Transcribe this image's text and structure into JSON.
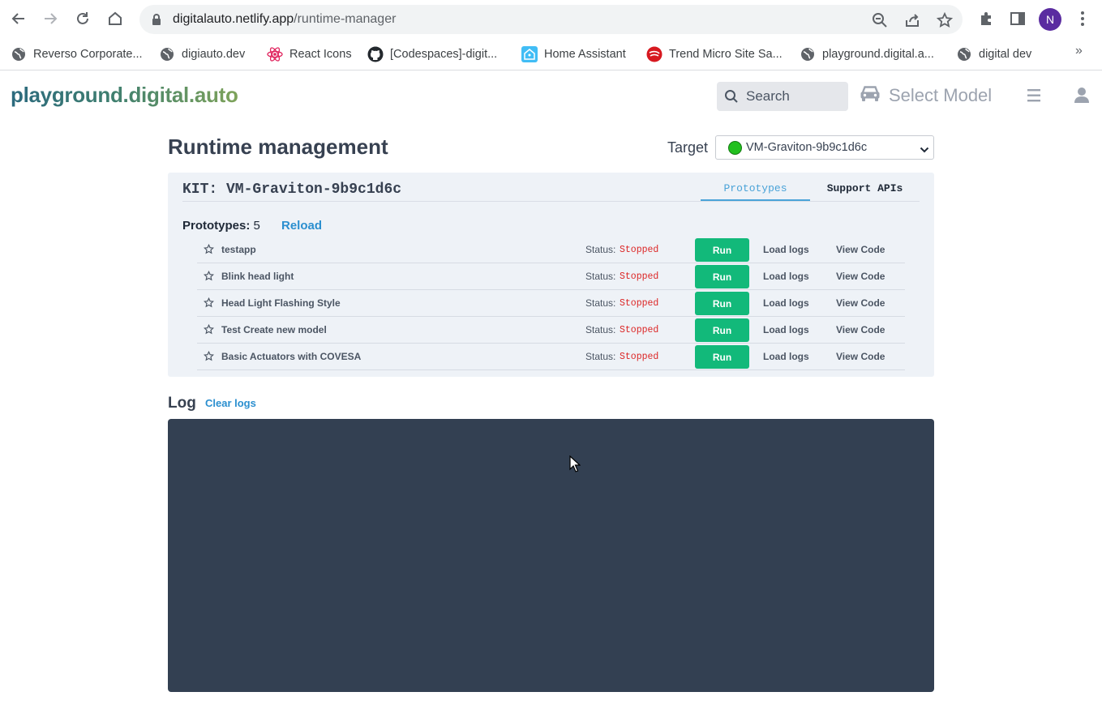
{
  "browser": {
    "url_domain": "digitalauto.netlify.app",
    "url_path": "/runtime-manager",
    "profile_initial": "N",
    "bookmarks": [
      {
        "label": "Reverso Corporate...",
        "icon": "globe-icon"
      },
      {
        "label": "digiauto.dev",
        "icon": "globe-icon"
      },
      {
        "label": "React Icons",
        "icon": "react-icon"
      },
      {
        "label": "[Codespaces]-digit...",
        "icon": "github-icon"
      },
      {
        "label": "Home Assistant",
        "icon": "home-assistant-icon"
      },
      {
        "label": "Trend Micro Site Sa...",
        "icon": "trend-micro-icon"
      },
      {
        "label": "playground.digital.a...",
        "icon": "globe-icon"
      },
      {
        "label": "digital dev",
        "icon": "globe-icon"
      }
    ],
    "more_bookmarks": "»"
  },
  "header": {
    "logo": "playground.digital.auto",
    "search_placeholder": "Search",
    "select_model": "Select Model"
  },
  "main": {
    "title": "Runtime management",
    "target_label": "Target",
    "target_value": "VM-Graviton-9b9c1d6c",
    "target_status_color": "#22c01f",
    "kit": {
      "title": "KIT: VM-Graviton-9b9c1d6c",
      "tabs": [
        {
          "label": "Prototypes",
          "active": true
        },
        {
          "label": "Support APIs",
          "active": false
        }
      ],
      "prototypes_label": "Prototypes:",
      "prototypes_count": "5",
      "reload_label": "Reload",
      "status_label": "Status:",
      "run_label": "Run",
      "load_logs_label": "Load logs",
      "view_code_label": "View Code",
      "prototypes": [
        {
          "name": "testapp",
          "status": "Stopped"
        },
        {
          "name": "Blink head light",
          "status": "Stopped"
        },
        {
          "name": "Head Light Flashing Style",
          "status": "Stopped"
        },
        {
          "name": "Test Create new model",
          "status": "Stopped"
        },
        {
          "name": "Basic Actuators with COVESA",
          "status": "Stopped"
        }
      ]
    },
    "log": {
      "title": "Log",
      "clear_label": "Clear logs",
      "content": ""
    }
  },
  "colors": {
    "run_button": "#12b97a",
    "status_stopped": "#dc2626",
    "link_blue": "#2b8fcf",
    "log_background": "#334052"
  }
}
